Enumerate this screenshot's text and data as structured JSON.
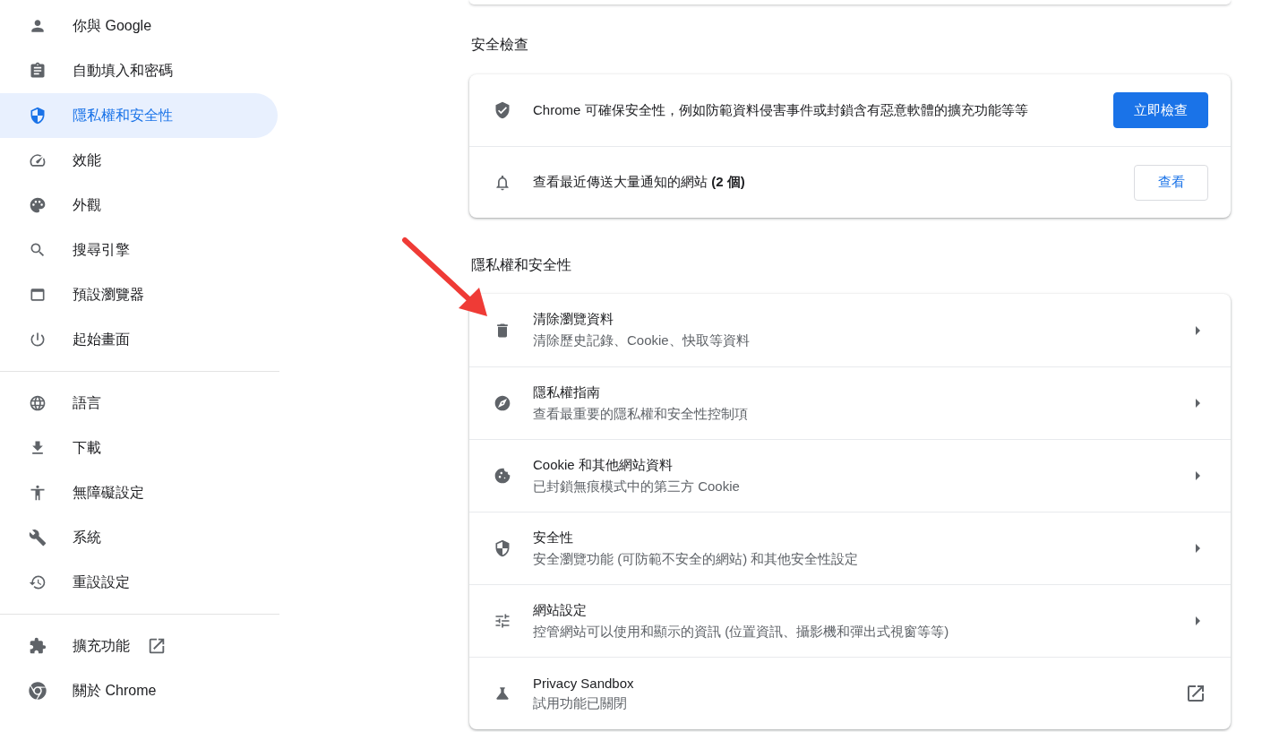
{
  "sidebar": {
    "sections": [
      {
        "items": [
          {
            "label": "你與 Google",
            "selected": false,
            "external": false
          },
          {
            "label": "自動填入和密碼",
            "selected": false,
            "external": false
          },
          {
            "label": "隱私權和安全性",
            "selected": true,
            "external": false
          },
          {
            "label": "效能",
            "selected": false,
            "external": false
          },
          {
            "label": "外觀",
            "selected": false,
            "external": false
          },
          {
            "label": "搜尋引擎",
            "selected": false,
            "external": false
          },
          {
            "label": "預設瀏覽器",
            "selected": false,
            "external": false
          },
          {
            "label": "起始畫面",
            "selected": false,
            "external": false
          }
        ]
      },
      {
        "items": [
          {
            "label": "語言",
            "selected": false,
            "external": false
          },
          {
            "label": "下載",
            "selected": false,
            "external": false
          },
          {
            "label": "無障礙設定",
            "selected": false,
            "external": false
          },
          {
            "label": "系統",
            "selected": false,
            "external": false
          },
          {
            "label": "重設設定",
            "selected": false,
            "external": false
          }
        ]
      },
      {
        "items": [
          {
            "label": "擴充功能",
            "selected": false,
            "external": true
          },
          {
            "label": "關於 Chrome",
            "selected": false,
            "external": false
          }
        ]
      }
    ]
  },
  "safety_check": {
    "title": "安全檢查",
    "rows": [
      {
        "text": "Chrome 可確保安全性，例如防範資料侵害事件或封鎖含有惡意軟體的擴充功能等等",
        "button": {
          "label": "立即檢查",
          "kind": "primary"
        }
      },
      {
        "text": "查看最近傳送大量通知的網站 **(2 個)**",
        "button": {
          "label": "查看",
          "kind": "outlined"
        }
      }
    ]
  },
  "privacy": {
    "title": "隱私權和安全性",
    "rows": [
      {
        "title": "清除瀏覽資料",
        "subtitle": "清除歷史記錄、Cookie、快取等資料",
        "kind": "chevron"
      },
      {
        "title": "隱私權指南",
        "subtitle": "查看最重要的隱私權和安全性控制項",
        "kind": "chevron"
      },
      {
        "title": "Cookie 和其他網站資料",
        "subtitle": "已封鎖無痕模式中的第三方 Cookie",
        "kind": "chevron"
      },
      {
        "title": "安全性",
        "subtitle": "安全瀏覽功能 (可防範不安全的網站) 和其他安全性設定",
        "kind": "chevron"
      },
      {
        "title": "網站設定",
        "subtitle": "控管網站可以使用和顯示的資訊 (位置資訊、攝影機和彈出式視窗等等)",
        "kind": "chevron"
      },
      {
        "title": "Privacy Sandbox",
        "subtitle": "試用功能已關閉",
        "kind": "external"
      }
    ]
  }
}
